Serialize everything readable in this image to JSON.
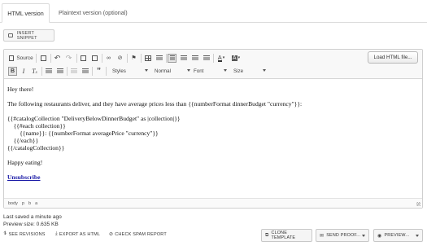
{
  "tabs": [
    {
      "label": "HTML version",
      "active": true
    },
    {
      "label": "Plaintext version (optional)",
      "active": false
    }
  ],
  "insert_snippet_label": "INSERT SNIPPET",
  "toolbar": {
    "source_label": "Source",
    "styles_label": "Styles",
    "format_label": "Normal",
    "font_label": "Font",
    "size_label": "Size",
    "load_html_label": "Load HTML file..."
  },
  "content_lines": [
    "Hey there!",
    "The following restaurants deliver, and they have average prices less than {{numberFormat dinnerBudget \"currency\"}}:",
    "{{#catalogCollection \"DeliveryBelowDinnerBudget\" as |collection|}}",
    "    {{#each collection}}",
    "        {{name}}: {{numberFormat averagePrice \"currency\"}}",
    "    {{/each}}",
    "{{/catalogCollection}}",
    "Happy eating!",
    "Unsubscribe"
  ],
  "element_path": [
    "body",
    "p",
    "b",
    "a"
  ],
  "last_saved": "Last saved a minute ago",
  "preview_size": "Preview size: 0.635 KB",
  "actions": {
    "see_revisions": "SEE REVISIONS",
    "export_html": "EXPORT AS HTML",
    "check_spam": "CHECK SPAM REPORT",
    "clone_template": "CLONE TEMPLATE",
    "send_proof": "SEND PROOF...",
    "preview": "PREVIEW..."
  },
  "icons": {
    "source": "source-doc-icon",
    "undo": "undo-icon",
    "redo": "redo-icon",
    "bold": "bold-icon",
    "italic": "italic-icon",
    "clear_format": "remove-format-icon"
  }
}
